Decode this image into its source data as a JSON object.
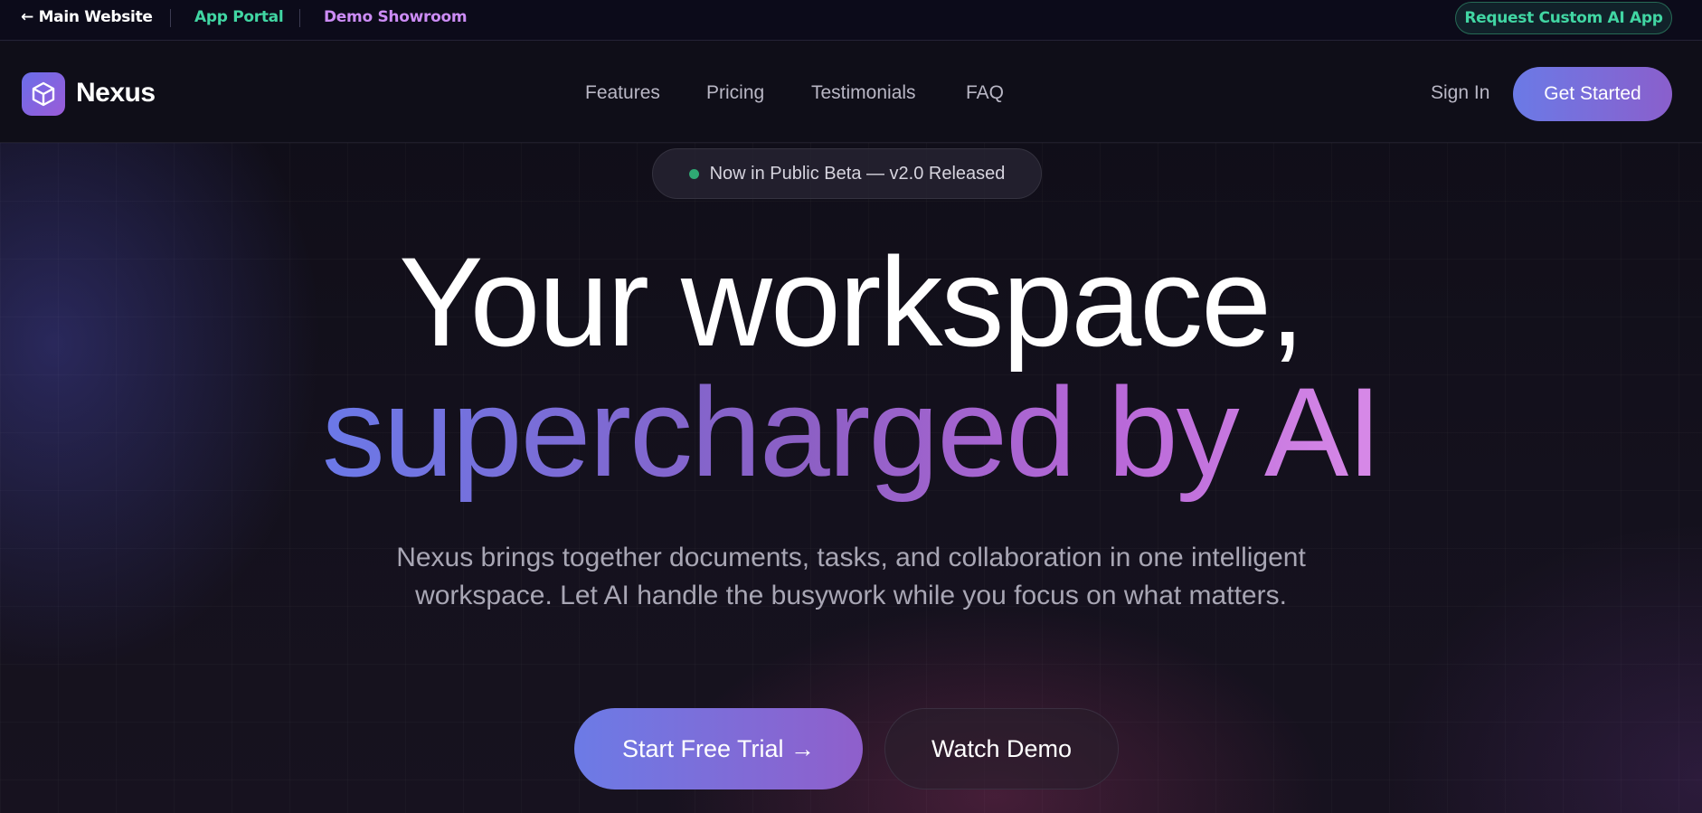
{
  "utility_bar": {
    "main_website": "← Main Website",
    "app_portal": "App Portal",
    "demo_showroom": "Demo Showroom",
    "request_button": "Request Custom AI App"
  },
  "nav": {
    "logo_text": "Nexus",
    "links": [
      "Features",
      "Pricing",
      "Testimonials",
      "FAQ"
    ],
    "sign_in": "Sign In",
    "get_started": "Get Started"
  },
  "hero": {
    "badge": "Now in Public Beta — v2.0 Released",
    "headline_line1": "Your workspace,",
    "headline_line2": "supercharged by AI",
    "description": "Nexus brings together documents, tasks, and collaboration in one intelligent workspace. Let AI handle the busywork while you focus on what matters.",
    "cta_primary": "Start Free Trial →",
    "cta_secondary": "Watch Demo"
  },
  "colors": {
    "accent_green": "#41d6a3",
    "accent_purple": "#cc8cf5",
    "gradient_start": "#6b7ae6",
    "gradient_end": "#d88ae8",
    "status_dot": "#2fa873"
  },
  "icons": {
    "logo": "cube-icon",
    "badge_status": "status-dot-icon"
  }
}
